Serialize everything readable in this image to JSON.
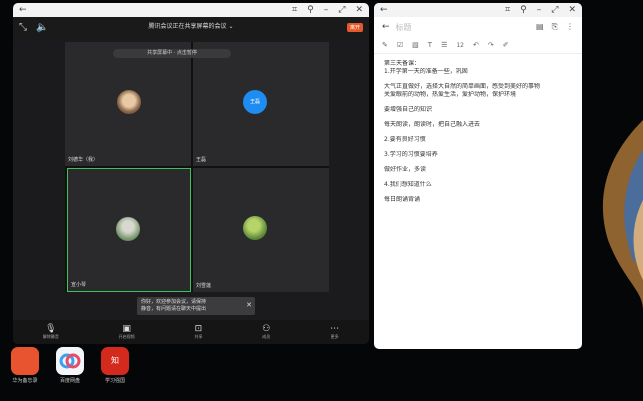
{
  "meeting": {
    "title": "腾讯会议正在共享屏幕的会议 ⌄",
    "subtitle": "",
    "leave": "离开",
    "share_pill": "共享屏幕中 · 点击暂停",
    "tiles": [
      {
        "name": "刘德华（我）"
      },
      {
        "name": "王磊",
        "avatar_text": "王磊"
      },
      {
        "name": "宣小琴"
      },
      {
        "name": "刘雪莲"
      }
    ],
    "left_mark": "",
    "toast": {
      "line1": "你好，欢迎参加会议，请保持",
      "line2": "静音，有问题请在聊天中提出"
    },
    "bottom": [
      {
        "label": "解除静音",
        "icon": "mic"
      },
      {
        "label": "开启视频",
        "icon": "video"
      },
      {
        "label": "共享",
        "icon": "share"
      },
      {
        "label": "成员",
        "icon": "members"
      },
      {
        "label": "更多",
        "icon": "more"
      }
    ]
  },
  "notes": {
    "title": "标题",
    "toolbar": {
      "size": "12"
    },
    "lines": [
      "第三天备课：",
      "1.开学第一天的准备一些，巩固",
      "",
      "大气正直做好，选择大自然的简单画面，感受到美好的事物",
      "关爱眼前的动物，热爱生活，爱护动物，保护环境",
      "",
      "要增强自己的知识",
      "",
      "每天朗读，朗读时，把自己融入进去",
      "",
      "2.要有良好习惯",
      "",
      "3.学习的习惯要培养",
      "",
      "做好作业，多读",
      "",
      "4.我们想知道什么",
      "",
      "每日朗诵背诵"
    ]
  },
  "dock": [
    {
      "label": "华为备忘录",
      "icon": "notes-app"
    },
    {
      "label": "百度网盘",
      "icon": "cloud-app"
    },
    {
      "label": "学习强国",
      "icon": "news-app",
      "glyph": "知"
    }
  ]
}
